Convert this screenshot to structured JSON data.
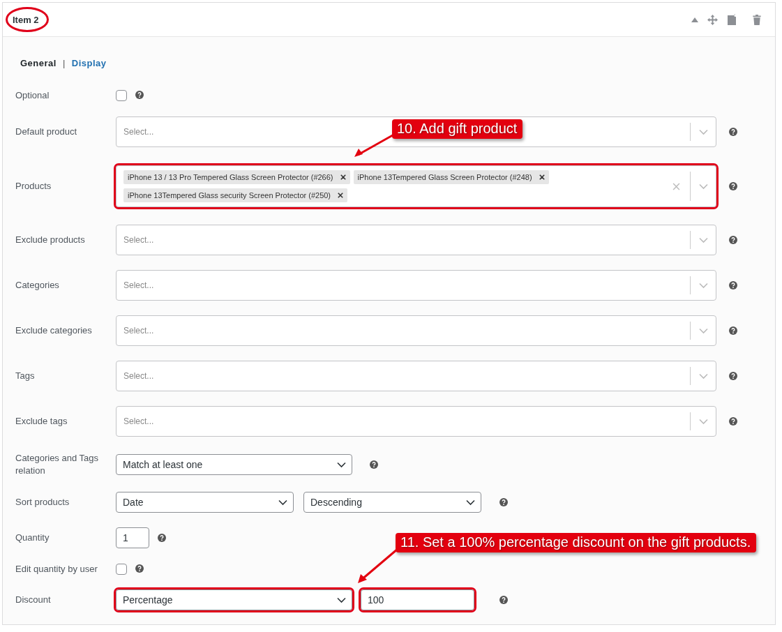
{
  "item": {
    "title": "Item 2",
    "circled": true
  },
  "tabs": [
    {
      "label": "General",
      "selected": true
    },
    {
      "label": "Display",
      "selected": false
    }
  ],
  "tab_separator": "|",
  "fields": [
    {
      "kind": "checkbox",
      "label": "Optional",
      "checked": false
    },
    {
      "kind": "multiselect",
      "label": "Default product",
      "placeholder": "Select...",
      "highlighted": false
    },
    {
      "kind": "multiselect",
      "label": "Products",
      "tags": [
        "iPhone 13 / 13 Pro Tempered Glass Screen Protector (#266)",
        "iPhone 13Tempered Glass Screen Protector (#248)",
        "iPhone 13Tempered Glass security Screen Protector (#250)"
      ],
      "highlighted": true
    },
    {
      "kind": "multiselect",
      "label": "Exclude products",
      "placeholder": "Select...",
      "highlighted": false
    },
    {
      "kind": "multiselect",
      "label": "Categories",
      "placeholder": "Select...",
      "highlighted": false
    },
    {
      "kind": "multiselect",
      "label": "Exclude categories",
      "placeholder": "Select...",
      "highlighted": false
    },
    {
      "kind": "multiselect",
      "label": "Tags",
      "placeholder": "Select...",
      "highlighted": false
    },
    {
      "kind": "multiselect",
      "label": "Exclude tags",
      "placeholder": "Select...",
      "highlighted": false
    },
    {
      "kind": "dropdown",
      "label": "Categories and Tags relation",
      "selects": [
        "Match at least one"
      ],
      "highlighted": false
    },
    {
      "kind": "dropdown",
      "label": "Sort products",
      "selects": [
        "Date",
        "Descending"
      ],
      "highlighted": false
    },
    {
      "kind": "number",
      "label": "Quantity",
      "value": "1",
      "highlighted": false
    },
    {
      "kind": "checkbox",
      "label": "Edit quantity by user",
      "checked": false
    },
    {
      "kind": "dropdown",
      "label": "Discount",
      "selects": [
        "Percentage"
      ],
      "value": "100",
      "highlighted": true
    }
  ],
  "callouts": [
    {
      "text": "10. Add gift product"
    },
    {
      "text": "11. Set a 100% percentage discount on the gift products."
    }
  ]
}
